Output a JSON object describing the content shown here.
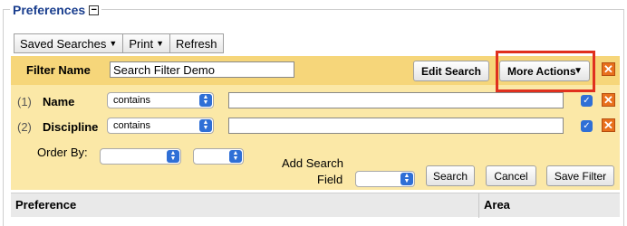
{
  "section": {
    "title": "Preferences",
    "collapse": "−"
  },
  "toolbar": {
    "saved_searches": "Saved Searches",
    "print": "Print",
    "refresh": "Refresh",
    "arrow": "▼"
  },
  "filter": {
    "label": "Filter Name",
    "name_value": "Search Filter Demo",
    "edit_search": "Edit Search",
    "more_actions": "More Actions",
    "remove": "✕"
  },
  "rows": [
    {
      "num": "(1)",
      "label": "Name",
      "operator": "contains",
      "value": ""
    },
    {
      "num": "(2)",
      "label": "Discipline",
      "operator": "contains",
      "value": ""
    }
  ],
  "order": {
    "label": "Order By:",
    "field1": "",
    "field2": ""
  },
  "add_field": {
    "label_line1": "Add Search",
    "label_line2": "Field",
    "value": ""
  },
  "actions": {
    "search": "Search",
    "cancel": "Cancel",
    "save_filter": "Save Filter"
  },
  "table": {
    "columns": [
      "Preference",
      "Area"
    ]
  },
  "icons": {
    "checkmark": "✓",
    "select_up": "▲",
    "select_down": "▼"
  },
  "colors": {
    "header_bar": "#f6d67a",
    "panel": "#fbe8a7",
    "highlight": "#e0301e",
    "remove": "#e8701c",
    "select_accent": "#2f6fd6",
    "legend": "#1a3e8e"
  }
}
